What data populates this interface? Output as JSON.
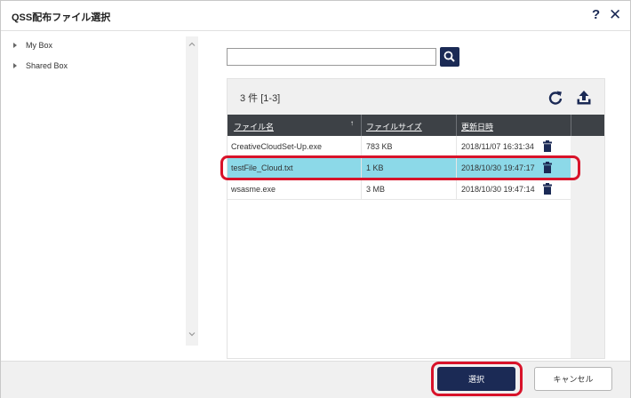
{
  "dialog": {
    "title": "QSS配布ファイル選択"
  },
  "icons": {
    "help": "help-icon",
    "close": "close-icon",
    "search": "search-icon",
    "refresh": "refresh-icon",
    "upload": "upload-icon",
    "trash": "trash-icon"
  },
  "sidebar": {
    "items": [
      {
        "label": "My Box"
      },
      {
        "label": "Shared Box"
      }
    ]
  },
  "search": {
    "value": "",
    "placeholder": ""
  },
  "files": {
    "count_label": "3 件  [1-3]",
    "headers": [
      "ファイル名",
      "ファイルサイズ",
      "更新日時"
    ],
    "sorted_column": "ファイル名",
    "rows": [
      {
        "name": "CreativeCloudSet-Up.exe",
        "size": "783 KB",
        "modified": "2018/11/07 16:31:34",
        "selected": false
      },
      {
        "name": "testFile_Cloud.txt",
        "size": "1 KB",
        "modified": "2018/10/30 19:47:17",
        "selected": true
      },
      {
        "name": "wsasme.exe",
        "size": "3 MB",
        "modified": "2018/10/30 19:47:14",
        "selected": false
      }
    ]
  },
  "footer": {
    "select_label": "選択",
    "cancel_label": "キャンセル"
  },
  "colors": {
    "navy": "#1b2a55",
    "selection": "#8cd9e8",
    "highlight": "#d8132a",
    "header_bg": "#3d4146"
  }
}
